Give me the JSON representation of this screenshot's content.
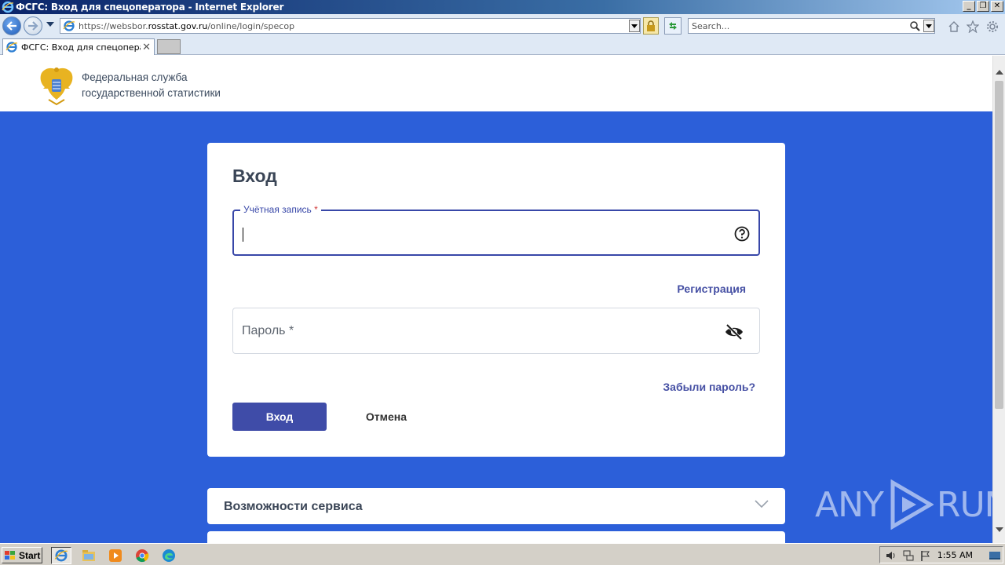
{
  "window": {
    "title": "ФСГС: Вход для спецоператора - Internet Explorer",
    "controls": [
      "_",
      "❐",
      "✕"
    ]
  },
  "navbar": {
    "url_prefix": "https://websbor.",
    "url_host": "rosstat.gov.ru",
    "url_path": "/online/login/specop",
    "search_placeholder": "Search..."
  },
  "tabs": [
    {
      "title": "ФСГС: Вход для спецопера...",
      "close": "✕"
    }
  ],
  "site": {
    "org_line1": "Федеральная служба",
    "org_line2": "государственной статистики"
  },
  "login": {
    "title": "Вход",
    "account_label": "Учётная запись",
    "required_mark": "*",
    "account_value": "",
    "register_link": "Регистрация",
    "password_placeholder": "Пароль *",
    "forgot_link": "Забыли пароль?",
    "submit_label": "Вход",
    "cancel_label": "Отмена"
  },
  "accordion": {
    "title": "Возможности сервиса"
  },
  "watermark": {
    "left": "ANY",
    "right": "RUN"
  },
  "taskbar": {
    "start_label": "Start",
    "clock": "1:55 AM"
  },
  "colors": {
    "page_blue": "#2c5fd9",
    "accent": "#3f4ca8",
    "link": "#4650a4"
  },
  "icons": [
    "ie-icon",
    "back-arrow-icon",
    "forward-arrow-icon",
    "lock-icon",
    "refresh-icon",
    "search-icon",
    "home-icon",
    "star-icon",
    "gear-icon",
    "help-icon",
    "eye-off-icon",
    "chevron-down-icon",
    "explorer-icon",
    "media-player-icon",
    "chrome-icon",
    "edge-icon",
    "speaker-icon",
    "network-icon",
    "flag-icon"
  ]
}
